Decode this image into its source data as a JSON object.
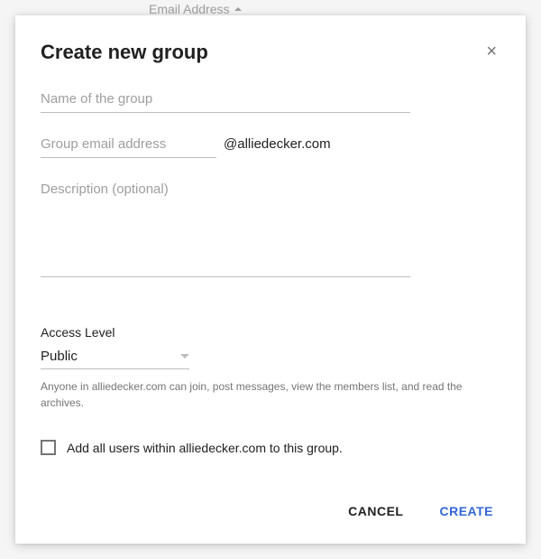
{
  "background": {
    "sortLabel": "Email Address"
  },
  "dialog": {
    "title": "Create new group",
    "fields": {
      "name": {
        "placeholder": "Name of the group",
        "value": ""
      },
      "email": {
        "placeholder": "Group email address",
        "value": "",
        "suffix": "@alliedecker.com"
      },
      "description": {
        "placeholder": "Description (optional)",
        "value": ""
      }
    },
    "access": {
      "label": "Access Level",
      "selected": "Public",
      "description": "Anyone in alliedecker.com can join, post messages, view the members list, and read the archives."
    },
    "checkbox": {
      "checked": false,
      "label": "Add all users within alliedecker.com to this group."
    },
    "buttons": {
      "cancel": "CANCEL",
      "create": "CREATE"
    }
  }
}
